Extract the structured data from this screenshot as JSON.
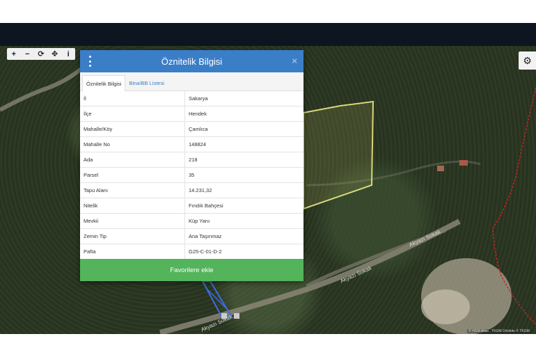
{
  "toolbar": {
    "zoom_in": "+",
    "zoom_out": "−",
    "refresh": "⟳",
    "locate": "✥",
    "info": "i"
  },
  "settings_icon": "gear-icon",
  "dialog": {
    "title": "Öznitelik Bilgisi",
    "close": "×",
    "tabs": [
      "Öznitelik Bilgisi",
      "Bina/BB Listesi"
    ],
    "rows": [
      {
        "label": "İl",
        "value": "Sakarya"
      },
      {
        "label": "İlçe",
        "value": "Hendek"
      },
      {
        "label": "Mahalle/Köy",
        "value": "Çamlıca"
      },
      {
        "label": "Mahalle No",
        "value": "148824"
      },
      {
        "label": "Ada",
        "value": "218"
      },
      {
        "label": "Parsel",
        "value": "35"
      },
      {
        "label": "Tapu Alanı",
        "value": "14.231,32"
      },
      {
        "label": "Nitelik",
        "value": "Fındık Bahçesi"
      },
      {
        "label": "Mevkii",
        "value": "Küp Yanı"
      },
      {
        "label": "Zemin Tip",
        "value": "Ana Taşınmaz"
      },
      {
        "label": "Pafta",
        "value": "G25-C-01-D-2"
      }
    ],
    "favorite_button": "Favorilere ekle"
  },
  "map_labels": {
    "road1": "Akyazı Sokak",
    "road2": "Akyazı Sokak",
    "road3": "Akyazı Sokak"
  },
  "attribution": "© HGM Atlas , TKGM Ortofoto © TKGM",
  "colors": {
    "header": "#3b7ec8",
    "favorite": "#54b45c",
    "parcel_outline": "#d8d87a",
    "boundary": "#cc2222"
  }
}
